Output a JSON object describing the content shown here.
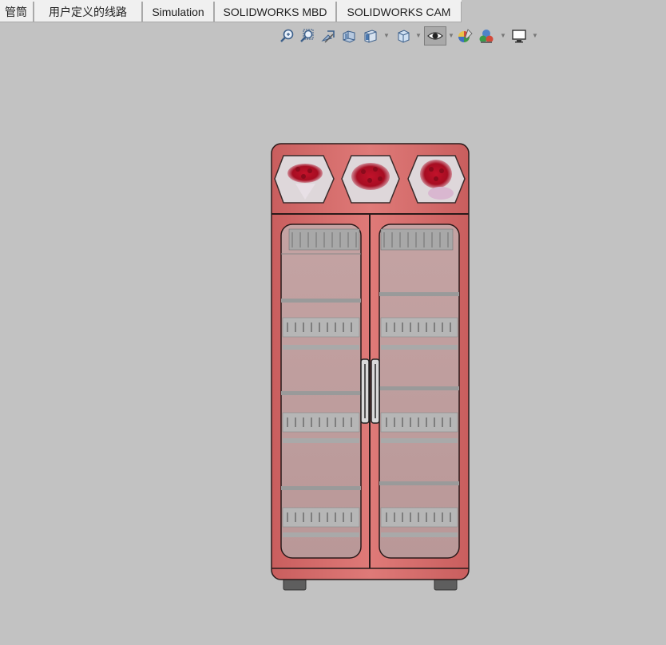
{
  "command_tabs": [
    {
      "label": "管筒"
    },
    {
      "label": "用户定义的线路"
    },
    {
      "label": "Simulation"
    },
    {
      "label": "SOLIDWORKS MBD"
    },
    {
      "label": "SOLIDWORKS CAM"
    }
  ],
  "heads_up_toolbar": {
    "buttons": [
      {
        "icon": "zoom-to-fit-icon"
      },
      {
        "icon": "zoom-to-area-icon"
      },
      {
        "icon": "previous-view-icon"
      },
      {
        "icon": "section-view-icon"
      },
      {
        "icon": "view-orientation-icon"
      },
      {
        "icon": "display-style-icon"
      },
      {
        "icon": "hide-show-items-icon"
      },
      {
        "icon": "edit-appearance-icon"
      },
      {
        "icon": "apply-scene-icon"
      },
      {
        "icon": "view-settings-icon"
      }
    ]
  },
  "colors": {
    "background": "#c2c2c2",
    "cabinet_body": "#d9706f",
    "cabinet_edge": "#2a1a1a",
    "glass": "#c9a9a9",
    "tab_bg": "#f0f0f0"
  }
}
